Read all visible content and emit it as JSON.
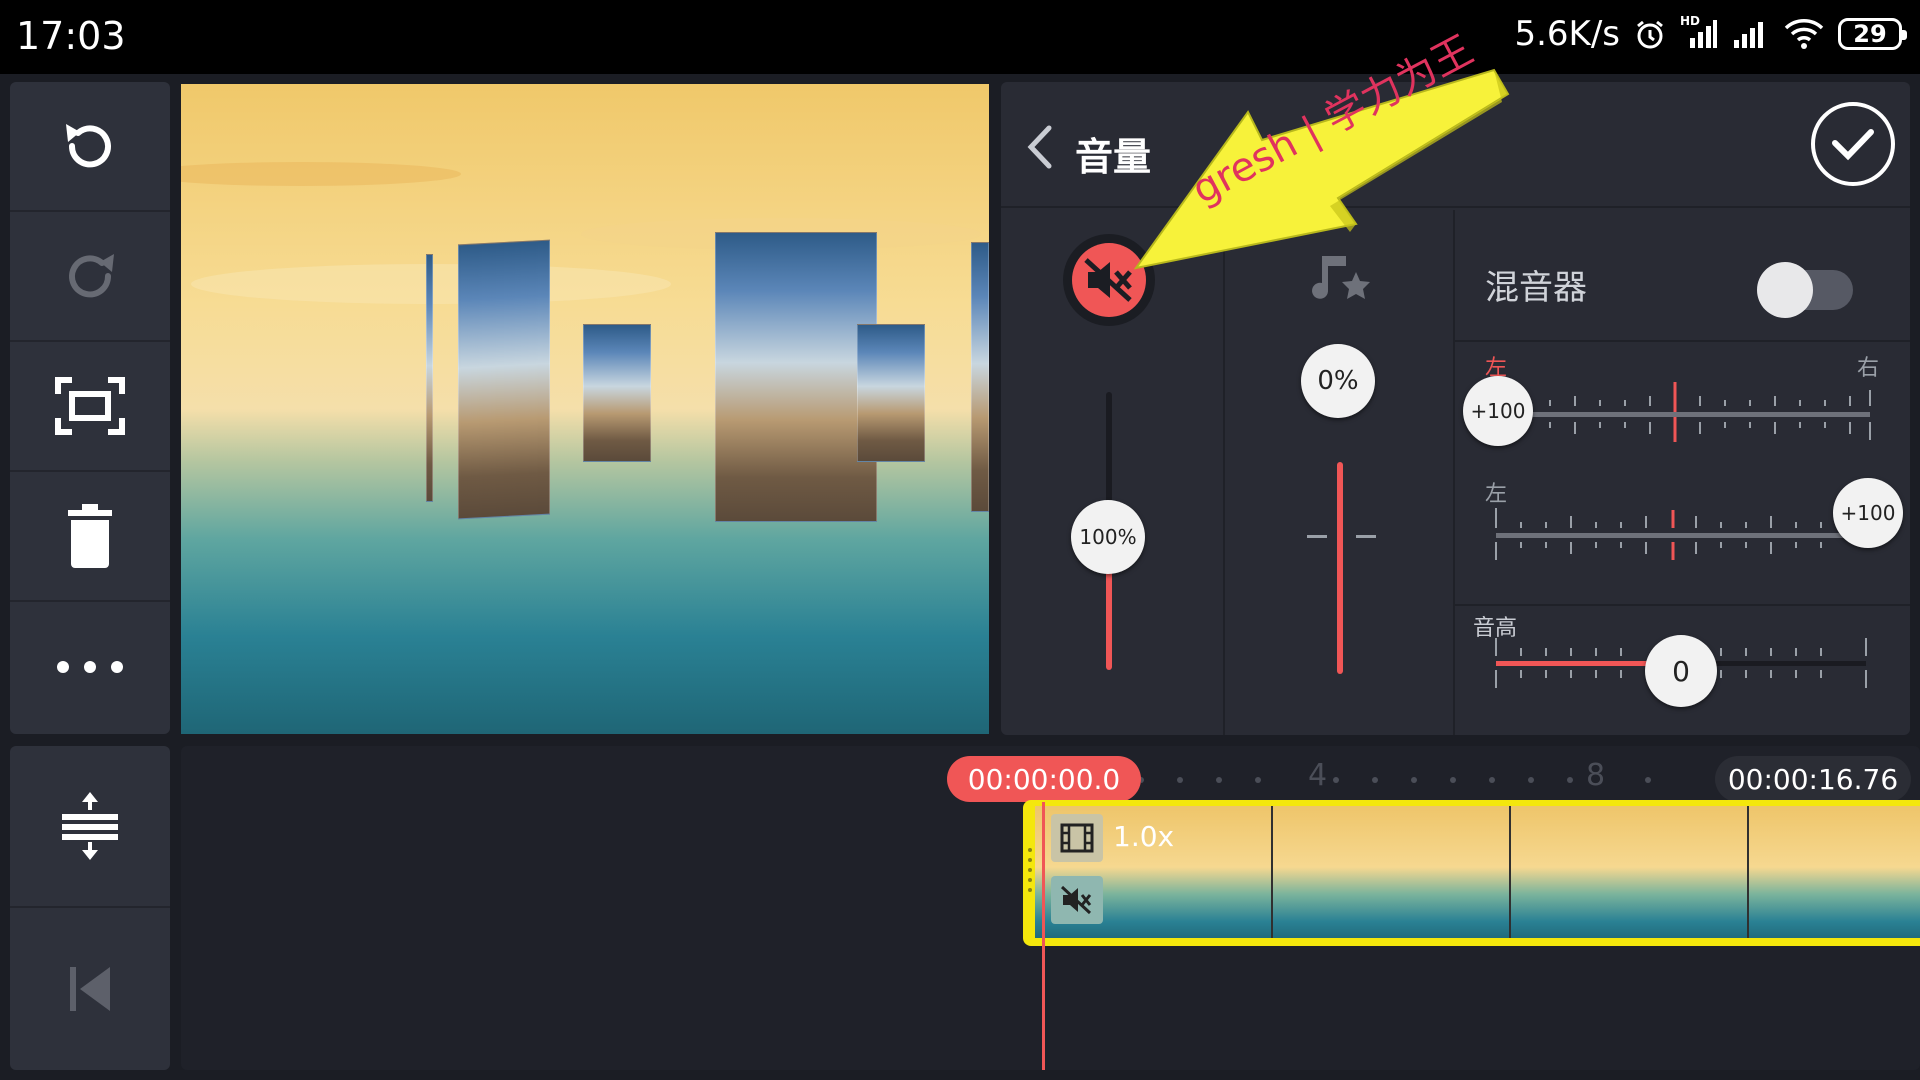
{
  "status_bar": {
    "time": "17:03",
    "net_speed": "5.6K/s",
    "hd_label": "HD",
    "battery": "29",
    "icons": [
      "alarm-icon",
      "hd-signal-icon",
      "signal-icon",
      "wifi-icon",
      "battery-icon"
    ]
  },
  "toolbar": {
    "tools": [
      "undo-icon",
      "redo-icon",
      "fullscreen-icon",
      "delete-icon",
      "more-icon"
    ],
    "bottom_tools": [
      "track-expand-icon",
      "skip-to-start-icon"
    ]
  },
  "volume_panel": {
    "title": "音量",
    "mute_state": "muted",
    "volume_value": "100%",
    "volume_level": 1.0,
    "effect_value": "0%",
    "effect_level": 0.0,
    "mixer_label": "混音器",
    "mixer_enabled": false,
    "pan_left_label": "左",
    "pan_right_label": "右",
    "pan1_value": "+100",
    "pan2_value": "+100",
    "pitch_label": "音高",
    "pitch_value": "0",
    "accent_color": "#f05656"
  },
  "annotation": {
    "text": "gresh | 学力为王",
    "color": "#f7f23a"
  },
  "timeline": {
    "current_time": "00:00:00.0",
    "total_time": "00:00:16.76",
    "ruler_marks": [
      "4",
      "8"
    ],
    "clip_speed": "1.0x"
  }
}
